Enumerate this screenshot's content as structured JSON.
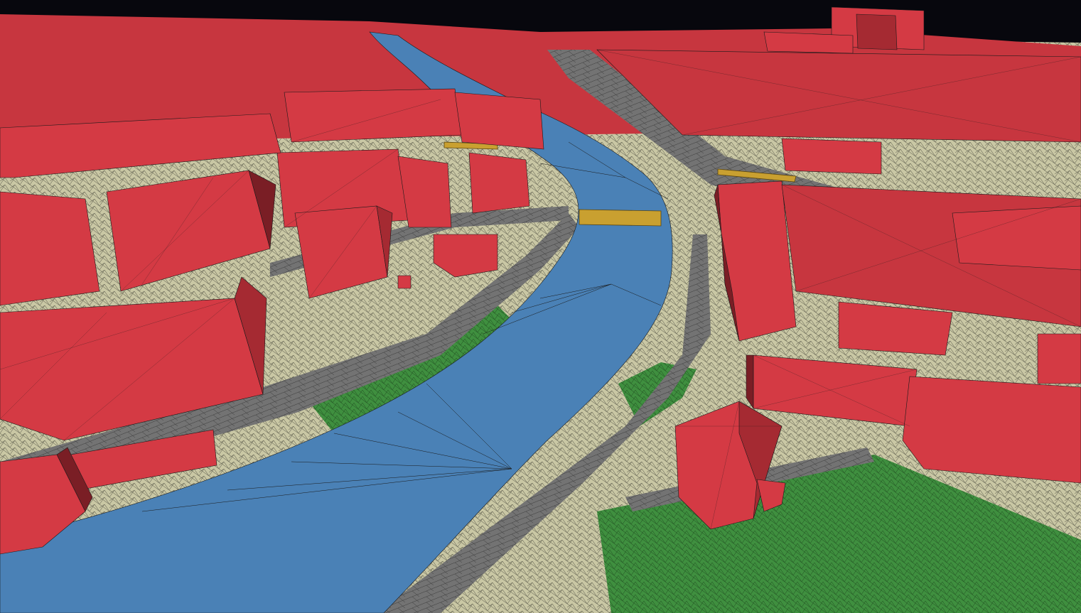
{
  "view": {
    "kind": "3d-city-mesh",
    "projection": "perspective-oblique",
    "wireframe": true
  },
  "palette": {
    "sky": "#07070d",
    "building_roof": "#d43a44",
    "building_wall": "#a52a32",
    "building_wall_dark": "#7a1e25",
    "road": "#737373",
    "road_light": "#8a8a8a",
    "water": "#4a81b6",
    "vegetation": "#3f8f3f",
    "terrain": "#c9c7a4",
    "bridge": "#c9a030",
    "mesh_edge": "#1a1a1a"
  },
  "legend": [
    {
      "class": "building",
      "color_key": "building_roof",
      "icon": "building-icon"
    },
    {
      "class": "water",
      "color_key": "water",
      "icon": "water-icon"
    },
    {
      "class": "road",
      "color_key": "road",
      "icon": "road-icon"
    },
    {
      "class": "vegetation",
      "color_key": "vegetation",
      "icon": "tree-icon"
    },
    {
      "class": "terrain",
      "color_key": "terrain",
      "icon": "terrain-icon"
    },
    {
      "class": "bridge",
      "color_key": "bridge",
      "icon": "bridge-icon"
    }
  ]
}
